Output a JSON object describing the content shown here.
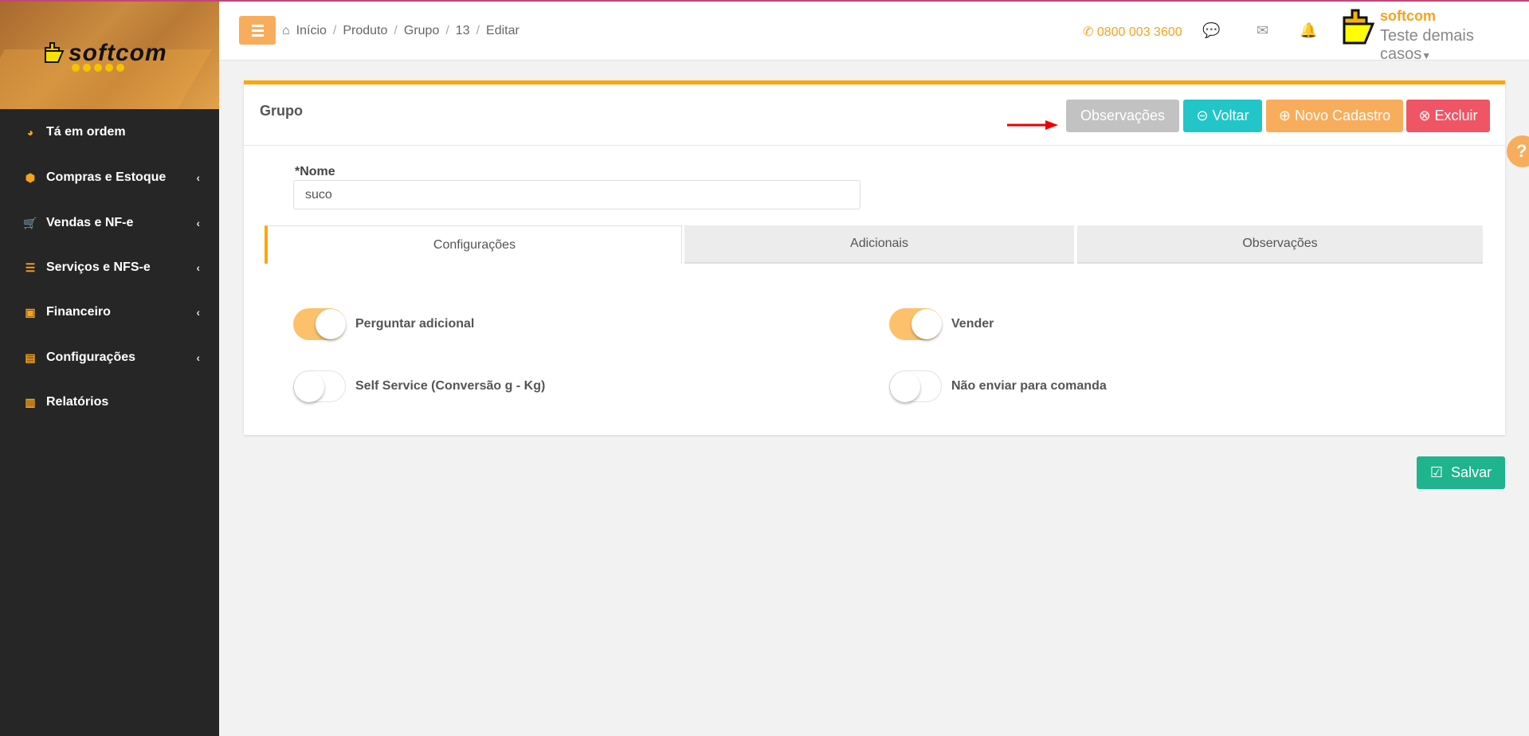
{
  "brand": {
    "logo_text": "softcom"
  },
  "sidebar": {
    "items": [
      {
        "label": "Tá em ordem",
        "icon": "pie-chart-icon",
        "glyph": "◕",
        "submenu": false
      },
      {
        "label": "Compras e Estoque",
        "icon": "cube-icon",
        "glyph": "⬢",
        "submenu": true
      },
      {
        "label": "Vendas e NF-e",
        "icon": "cart-icon",
        "glyph": "🛒",
        "submenu": true
      },
      {
        "label": "Serviços e NFS-e",
        "icon": "list-icon",
        "glyph": "☰",
        "submenu": true
      },
      {
        "label": "Financeiro",
        "icon": "money-icon",
        "glyph": "▣",
        "submenu": true
      },
      {
        "label": "Configurações",
        "icon": "newspaper-icon",
        "glyph": "▤",
        "submenu": true
      },
      {
        "label": "Relatórios",
        "icon": "bar-chart-icon",
        "glyph": "▥",
        "submenu": false
      }
    ],
    "chevron": "‹"
  },
  "breadcrumb": [
    "Início",
    "Produto",
    "Grupo",
    "13",
    "Editar"
  ],
  "breadcrumb_sep": "/",
  "header": {
    "phone": "0800 003 3600",
    "user_company": "softcom",
    "user_name": "Teste demais casos"
  },
  "card": {
    "title": "Grupo",
    "buttons": {
      "observacoes": "Observações",
      "voltar": "Voltar",
      "novo": "Novo Cadastro",
      "excluir": "Excluir"
    }
  },
  "form": {
    "nome_label": "*Nome",
    "nome_value": "suco"
  },
  "tabs": [
    "Configurações",
    "Adicionais",
    "Observações"
  ],
  "toggles": [
    {
      "label": "Perguntar adicional",
      "on": true
    },
    {
      "label": "Vender",
      "on": true
    },
    {
      "label": "Self Service (Conversão g - Kg)",
      "on": false
    },
    {
      "label": "Não enviar para comanda",
      "on": false
    }
  ],
  "save_label": "Salvar",
  "help_glyph": "?",
  "colors": {
    "accent": "#ffa500",
    "teal": "#22c5c8",
    "orange": "#f8ad5c",
    "red": "#ef5565",
    "gray": "#c2c2c2",
    "green": "#1fb38e"
  }
}
